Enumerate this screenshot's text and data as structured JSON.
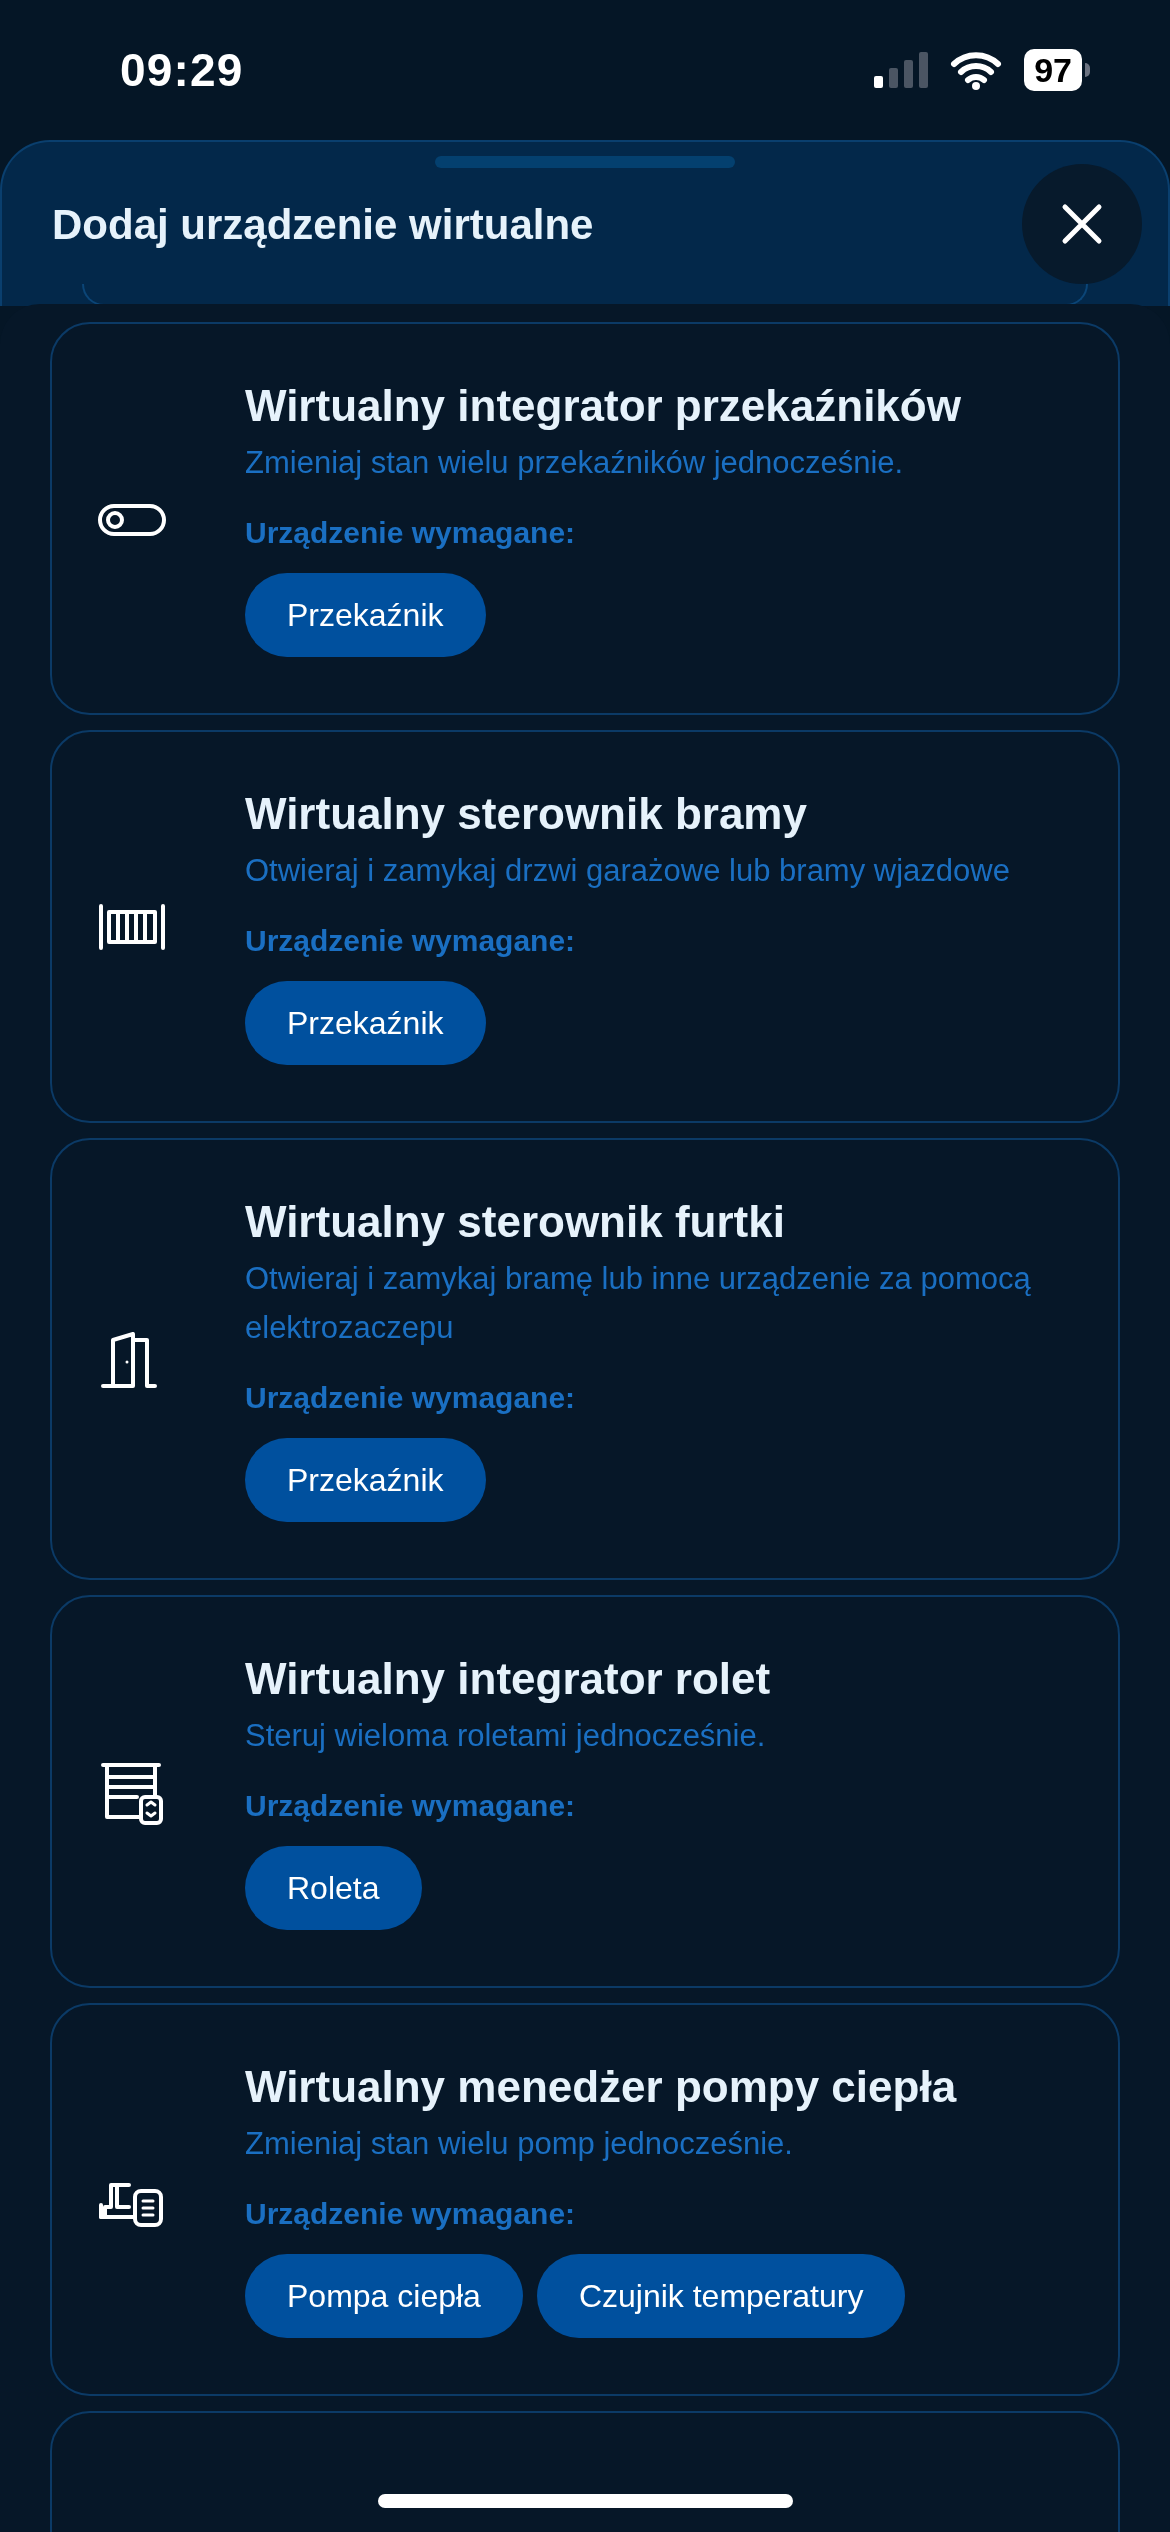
{
  "status_bar": {
    "time": "09:29",
    "battery": "97"
  },
  "sheet": {
    "title": "Dodaj urządzenie wirtualne"
  },
  "devices": [
    {
      "title": "Wirtualny integrator przekaźników",
      "description": "Zmieniaj stan wielu przekaźników jednocześnie.",
      "required_label": "Urządzenie wymagane:",
      "required": [
        "Przekaźnik"
      ]
    },
    {
      "title": "Wirtualny sterownik bramy",
      "description": "Otwieraj i zamykaj drzwi garażowe lub bramy wjazdowe",
      "required_label": "Urządzenie wymagane:",
      "required": [
        "Przekaźnik"
      ]
    },
    {
      "title": "Wirtualny sterownik furtki",
      "description": "Otwieraj i zamykaj bramę lub inne urządzenie za pomocą elektrozaczepu",
      "required_label": "Urządzenie wymagane:",
      "required": [
        "Przekaźnik"
      ]
    },
    {
      "title": "Wirtualny integrator rolet",
      "description": "Steruj wieloma roletami jednocześnie.",
      "required_label": "Urządzenie wymagane:",
      "required": [
        "Roleta"
      ]
    },
    {
      "title": "Wirtualny menedżer pompy ciepła",
      "description": "Zmieniaj stan wielu pomp jednocześnie.",
      "required_label": "Urządzenie wymagane:",
      "required": [
        "Pompa ciepła",
        "Czujnik temperatury"
      ]
    }
  ]
}
